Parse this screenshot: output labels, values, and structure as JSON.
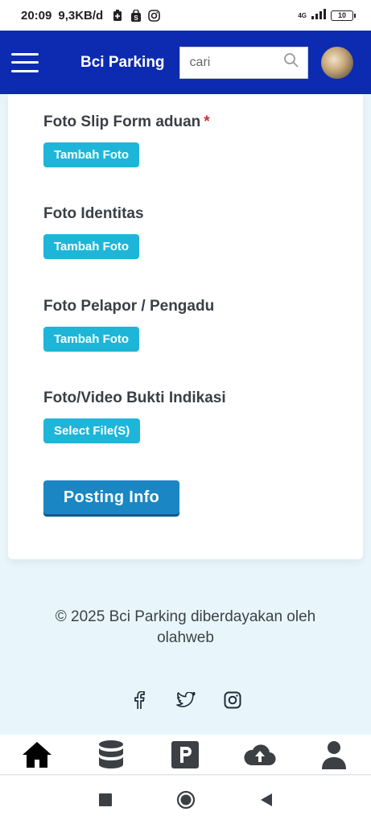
{
  "status_bar": {
    "time": "20:09",
    "speed": "9,3KB/d",
    "network": "4G",
    "battery": "10"
  },
  "app_bar": {
    "title": "Bci Parking",
    "search_placeholder": "cari"
  },
  "form": {
    "fields": [
      {
        "label": "Foto Slip Form aduan",
        "required_mark": "*",
        "button": "Tambah Foto"
      },
      {
        "label": "Foto Identitas",
        "button": "Tambah Foto"
      },
      {
        "label": "Foto Pelapor / Pengadu",
        "button": "Tambah Foto"
      },
      {
        "label": "Foto/Video Bukti Indikasi",
        "button": "Select File(S)"
      }
    ],
    "submit_label": "Posting Info"
  },
  "footer": {
    "copyright": "© 2025 Bci Parking diberdayakan oleh",
    "credit": "olahweb"
  },
  "bottom_nav": [
    "home-icon",
    "database-icon",
    "parking-icon",
    "cloud-upload-icon",
    "user-icon"
  ],
  "colors": {
    "app_bar": "#0c2bb0",
    "small_button": "#1eb6d8",
    "submit_button": "#1a87c4",
    "required": "#d32f2f",
    "page_background": "#e8f6fb"
  }
}
